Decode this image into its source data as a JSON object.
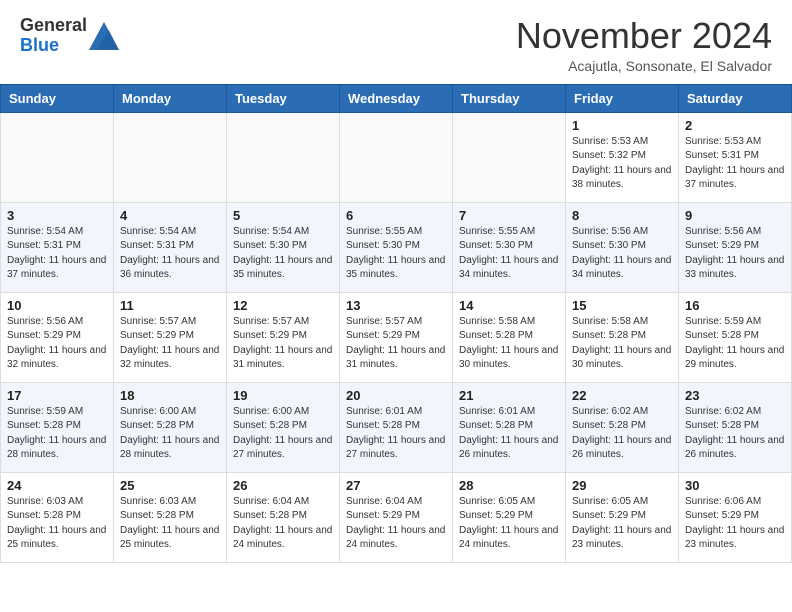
{
  "header": {
    "logo_general": "General",
    "logo_blue": "Blue",
    "month_title": "November 2024",
    "subtitle": "Acajutla, Sonsonate, El Salvador"
  },
  "days_of_week": [
    "Sunday",
    "Monday",
    "Tuesday",
    "Wednesday",
    "Thursday",
    "Friday",
    "Saturday"
  ],
  "weeks": [
    [
      {
        "day": "",
        "info": ""
      },
      {
        "day": "",
        "info": ""
      },
      {
        "day": "",
        "info": ""
      },
      {
        "day": "",
        "info": ""
      },
      {
        "day": "",
        "info": ""
      },
      {
        "day": "1",
        "info": "Sunrise: 5:53 AM\nSunset: 5:32 PM\nDaylight: 11 hours\nand 38 minutes."
      },
      {
        "day": "2",
        "info": "Sunrise: 5:53 AM\nSunset: 5:31 PM\nDaylight: 11 hours\nand 37 minutes."
      }
    ],
    [
      {
        "day": "3",
        "info": "Sunrise: 5:54 AM\nSunset: 5:31 PM\nDaylight: 11 hours\nand 37 minutes."
      },
      {
        "day": "4",
        "info": "Sunrise: 5:54 AM\nSunset: 5:31 PM\nDaylight: 11 hours\nand 36 minutes."
      },
      {
        "day": "5",
        "info": "Sunrise: 5:54 AM\nSunset: 5:30 PM\nDaylight: 11 hours\nand 35 minutes."
      },
      {
        "day": "6",
        "info": "Sunrise: 5:55 AM\nSunset: 5:30 PM\nDaylight: 11 hours\nand 35 minutes."
      },
      {
        "day": "7",
        "info": "Sunrise: 5:55 AM\nSunset: 5:30 PM\nDaylight: 11 hours\nand 34 minutes."
      },
      {
        "day": "8",
        "info": "Sunrise: 5:56 AM\nSunset: 5:30 PM\nDaylight: 11 hours\nand 34 minutes."
      },
      {
        "day": "9",
        "info": "Sunrise: 5:56 AM\nSunset: 5:29 PM\nDaylight: 11 hours\nand 33 minutes."
      }
    ],
    [
      {
        "day": "10",
        "info": "Sunrise: 5:56 AM\nSunset: 5:29 PM\nDaylight: 11 hours\nand 32 minutes."
      },
      {
        "day": "11",
        "info": "Sunrise: 5:57 AM\nSunset: 5:29 PM\nDaylight: 11 hours\nand 32 minutes."
      },
      {
        "day": "12",
        "info": "Sunrise: 5:57 AM\nSunset: 5:29 PM\nDaylight: 11 hours\nand 31 minutes."
      },
      {
        "day": "13",
        "info": "Sunrise: 5:57 AM\nSunset: 5:29 PM\nDaylight: 11 hours\nand 31 minutes."
      },
      {
        "day": "14",
        "info": "Sunrise: 5:58 AM\nSunset: 5:28 PM\nDaylight: 11 hours\nand 30 minutes."
      },
      {
        "day": "15",
        "info": "Sunrise: 5:58 AM\nSunset: 5:28 PM\nDaylight: 11 hours\nand 30 minutes."
      },
      {
        "day": "16",
        "info": "Sunrise: 5:59 AM\nSunset: 5:28 PM\nDaylight: 11 hours\nand 29 minutes."
      }
    ],
    [
      {
        "day": "17",
        "info": "Sunrise: 5:59 AM\nSunset: 5:28 PM\nDaylight: 11 hours\nand 28 minutes."
      },
      {
        "day": "18",
        "info": "Sunrise: 6:00 AM\nSunset: 5:28 PM\nDaylight: 11 hours\nand 28 minutes."
      },
      {
        "day": "19",
        "info": "Sunrise: 6:00 AM\nSunset: 5:28 PM\nDaylight: 11 hours\nand 27 minutes."
      },
      {
        "day": "20",
        "info": "Sunrise: 6:01 AM\nSunset: 5:28 PM\nDaylight: 11 hours\nand 27 minutes."
      },
      {
        "day": "21",
        "info": "Sunrise: 6:01 AM\nSunset: 5:28 PM\nDaylight: 11 hours\nand 26 minutes."
      },
      {
        "day": "22",
        "info": "Sunrise: 6:02 AM\nSunset: 5:28 PM\nDaylight: 11 hours\nand 26 minutes."
      },
      {
        "day": "23",
        "info": "Sunrise: 6:02 AM\nSunset: 5:28 PM\nDaylight: 11 hours\nand 26 minutes."
      }
    ],
    [
      {
        "day": "24",
        "info": "Sunrise: 6:03 AM\nSunset: 5:28 PM\nDaylight: 11 hours\nand 25 minutes."
      },
      {
        "day": "25",
        "info": "Sunrise: 6:03 AM\nSunset: 5:28 PM\nDaylight: 11 hours\nand 25 minutes."
      },
      {
        "day": "26",
        "info": "Sunrise: 6:04 AM\nSunset: 5:28 PM\nDaylight: 11 hours\nand 24 minutes."
      },
      {
        "day": "27",
        "info": "Sunrise: 6:04 AM\nSunset: 5:29 PM\nDaylight: 11 hours\nand 24 minutes."
      },
      {
        "day": "28",
        "info": "Sunrise: 6:05 AM\nSunset: 5:29 PM\nDaylight: 11 hours\nand 24 minutes."
      },
      {
        "day": "29",
        "info": "Sunrise: 6:05 AM\nSunset: 5:29 PM\nDaylight: 11 hours\nand 23 minutes."
      },
      {
        "day": "30",
        "info": "Sunrise: 6:06 AM\nSunset: 5:29 PM\nDaylight: 11 hours\nand 23 minutes."
      }
    ]
  ]
}
